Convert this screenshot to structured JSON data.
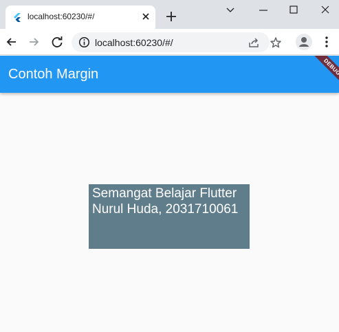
{
  "browser": {
    "tab": {
      "title": "localhost:60230/#/",
      "favicon": "flutter-icon"
    },
    "url": "localhost:60230/#/",
    "icons": [
      "close-icon",
      "plus-icon",
      "chevron-down-icon",
      "minimize-icon",
      "maximize-icon",
      "window-close-icon",
      "back-arrow-icon",
      "forward-arrow-icon",
      "reload-icon",
      "info-icon",
      "share-icon",
      "star-icon",
      "profile-icon",
      "menu-dots-icon"
    ]
  },
  "app": {
    "title": "Contoh Margin",
    "debug_banner": "DEBUG",
    "appbar_color": "#2196f3",
    "box_color": "#607d8b",
    "box_lines": [
      "Semangat Belajar Flutter",
      "Nurul Huda, 2031710061"
    ]
  }
}
